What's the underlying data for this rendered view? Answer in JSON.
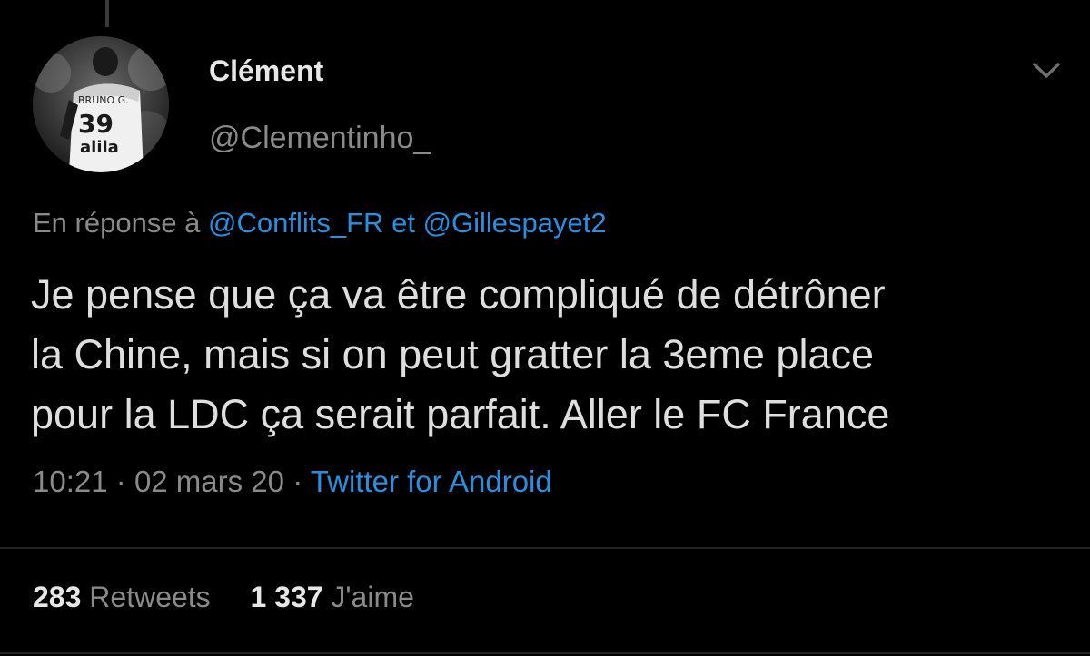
{
  "author": {
    "display_name": "Clément",
    "handle": "@Clementinho_",
    "avatar": {
      "jersey_name": "BRUNO G.",
      "jersey_number": "39",
      "sponsor": "alila"
    }
  },
  "reply": {
    "prefix": "En réponse à",
    "mention_1": "@Conflits_FR",
    "conjunction": "et",
    "mention_2": "@Gillespayet2"
  },
  "tweet": {
    "lines": [
      "Je pense que ça va être compliqué de détrôner",
      "la Chine, mais si on peut gratter la 3eme place",
      "pour la LDC ça serait parfait. Aller le FC France"
    ]
  },
  "meta": {
    "time": "10:21",
    "date": "02 mars 20",
    "separator": "·",
    "source": "Twitter for Android"
  },
  "stats": {
    "retweets_count": "283",
    "retweets_label": "Retweets",
    "likes_count": "1 337",
    "likes_label": "J'aime"
  },
  "icons": {
    "menu": "chevron-down-icon"
  },
  "colors": {
    "background": "#000000",
    "link": "#2b8fe0",
    "secondary_text": "#8a8a8a",
    "primary_text": "#e7e7e7"
  }
}
